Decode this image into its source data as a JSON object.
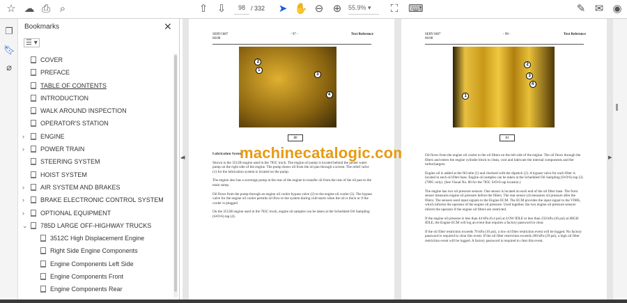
{
  "toolbar": {
    "current_page": "98",
    "total_pages": "/ 332",
    "zoom": "55.9%"
  },
  "bookmarks": {
    "title": "Bookmarks",
    "items": [
      {
        "label": "COVER",
        "expandable": false
      },
      {
        "label": "PREFACE",
        "expandable": false
      },
      {
        "label": "TABLE OF CONTENTS",
        "expandable": false
      },
      {
        "label": "INTRODUCTION",
        "expandable": false
      },
      {
        "label": "WALK AROUND INSPECTION",
        "expandable": false
      },
      {
        "label": "OPERATOR'S STATION",
        "expandable": false
      },
      {
        "label": "ENGINE",
        "expandable": true
      },
      {
        "label": "POWER TRAIN",
        "expandable": true
      },
      {
        "label": "STEERING SYSTEM",
        "expandable": false
      },
      {
        "label": "HOIST SYSTEM",
        "expandable": false
      },
      {
        "label": "AIR SYSTEM AND BRAKES",
        "expandable": true
      },
      {
        "label": "BRAKE ELECTRONIC CONTROL SYSTEM",
        "expandable": true
      },
      {
        "label": "OPTIONAL EQUIPMENT",
        "expandable": true
      },
      {
        "label": "785D LARGE OFF-HIGHWAY TRUCKS",
        "expandable": true,
        "expanded": true
      },
      {
        "label": "3512C High Displacement Engine",
        "child": true
      },
      {
        "label": "Right Side Engine Components",
        "child": true
      },
      {
        "label": "Engine Components Left Side",
        "child": true
      },
      {
        "label": "Engine Components Front",
        "child": true
      },
      {
        "label": "Engine Components Rear",
        "child": true
      }
    ]
  },
  "watermark": "machinecatalogic.com",
  "pages": [
    {
      "doc_id": "SERV1887",
      "date": "06/08",
      "page_no": "- 97 -",
      "section": "Text Reference",
      "visual_no": "80",
      "callouts": [
        "1",
        "2",
        "3",
        "4"
      ],
      "heading": "Lubrication System",
      "paragraphs": [
        "Shown is the 3512B engine used in the 785C truck.  The engine oil pump is located behind the jacket water pump on the right side of the engine.  The pump draws oil from the oil pan through a screen.  The relief valve (1) for the lubrication system is located on the pump.",
        "The engine also has a scavenge pump at the rear of the engine to transfer oil from the rear of the oil pan to the main sump.",
        "Oil flows from the pump through an engine oil cooler bypass valve (2) to the engine oil cooler (3).  The bypass valve for the engine oil cooler permits oil flow to the system during cold starts when the oil is thick or if the cooler is plugged.",
        "On the 3512B engine used in the 785C truck, engine oil samples can be taken at the Scheduled Oil Sampling (S•O•S) tap (4)."
      ]
    },
    {
      "doc_id": "SERV1887",
      "date": "06/08",
      "page_no": "- 98 -",
      "section": "Text Reference",
      "visual_no": "81",
      "callouts": [
        "1",
        "2",
        "3",
        "4"
      ],
      "paragraphs": [
        "Oil flows from the engine oil cooler to the oil filters on the left side of the engine.  The oil flows through the filters and enters the engine cylinder block to clean, cool and lubricate the internal components and the turbochargers.",
        "Engine oil is added at the fill tube (1) and checked with the dipstick (2).  A bypass valve for each filter is located in each oil filter base.  Engine oil samples can be taken at the Scheduled Oil Sampling (S•O•S) tap (3) (789C only).  (See Visual No. 80 for the 785C S•O•S tap location.)",
        "The engine has two oil pressure sensors.  One sensor is located on each end of the oil filter base.  The front sensor measures engine oil pressure before the filters.  The rear sensor (4) measures oil pressure after the filters.  The sensors send input signals to the Engine ECM.  The ECM provides the input signal to the VIMS, which informs the operator of the engine oil pressure.  Used together, the two engine oil pressure sensors inform the operator if the engine oil filters are restricted.",
        "If the engine oil pressure is less than 44 kPa (6.4 psi) at LOW IDLE to less than 250 kPa (36 psi) at HIGH IDLE, the Engine ECM will log an event that requires a factory password to clear.",
        "If the oil filter restriction exceeds 70 kPa (10 psi), a low oil filter restriction event will be logged.  No factory password is required to clear this event.  If the oil filter restriction exceeds 200 kPa (29 psi), a high oil filter restriction event will be logged.  A factory password is required to clear this event."
      ]
    }
  ]
}
